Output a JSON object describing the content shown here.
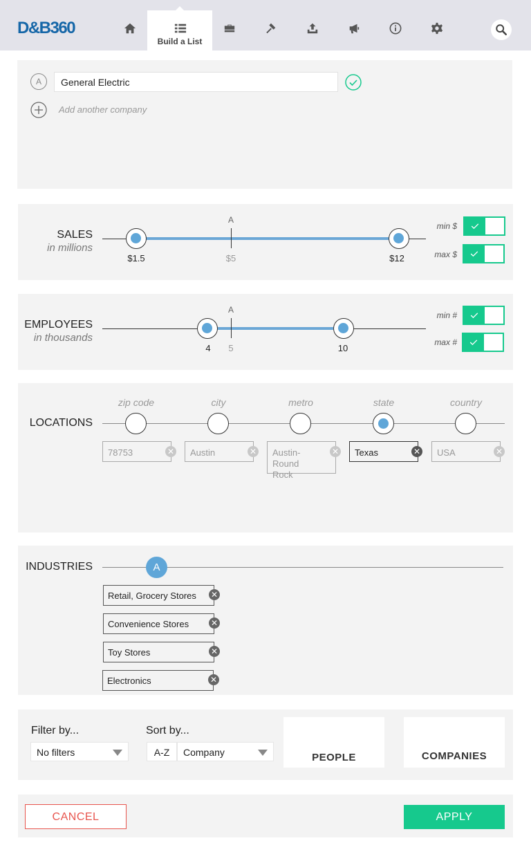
{
  "app": {
    "logo": "D&B360"
  },
  "nav": {
    "items": [
      {
        "icon": "home-icon"
      },
      {
        "icon": "list-icon",
        "label": "Build a List",
        "active": true
      },
      {
        "icon": "briefcase-icon"
      },
      {
        "icon": "gavel-icon"
      },
      {
        "icon": "upload-icon"
      },
      {
        "icon": "megaphone-icon"
      },
      {
        "icon": "info-icon"
      },
      {
        "icon": "gear-icon"
      }
    ],
    "search_icon": "search-icon"
  },
  "companies": {
    "items": [
      {
        "letter": "A",
        "value": "General Electric",
        "verified": true
      }
    ],
    "add_placeholder": "Add another company"
  },
  "sales": {
    "label": "SALES",
    "sublabel": "in millions",
    "marker_letter": "A",
    "min_value": "$1.5",
    "marker_value": "$5",
    "max_value": "$12",
    "min_toggle_label": "min $",
    "max_toggle_label": "max $",
    "min_enabled": true,
    "max_enabled": true
  },
  "employees": {
    "label": "EMPLOYEES",
    "sublabel": "in thousands",
    "marker_letter": "A",
    "min_value": "4",
    "marker_value": "5",
    "max_value": "10",
    "min_toggle_label": "min #",
    "max_toggle_label": "max #",
    "min_enabled": true,
    "max_enabled": true
  },
  "locations": {
    "label": "LOCATIONS",
    "levels": [
      {
        "heading": "zip code",
        "value": "78753",
        "selected": false
      },
      {
        "heading": "city",
        "value": "Austin",
        "selected": false
      },
      {
        "heading": "metro",
        "value": "Austin-Round Rock",
        "selected": false
      },
      {
        "heading": "state",
        "value": "Texas",
        "selected": true
      },
      {
        "heading": "country",
        "value": "USA",
        "selected": false
      }
    ]
  },
  "industries": {
    "label": "INDUSTRIES",
    "marker_letter": "A",
    "items": [
      "Retail, Grocery Stores",
      "Convenience Stores",
      "Toy Stores",
      "Electronics"
    ]
  },
  "filter": {
    "filter_label": "Filter by...",
    "filter_value": "No filters",
    "sort_label": "Sort by...",
    "sort_order": "A-Z",
    "sort_value": "Company",
    "people_button": "PEOPLE",
    "companies_button": "COMPANIES"
  },
  "actions": {
    "cancel": "CANCEL",
    "apply": "APPLY"
  },
  "colors": {
    "accent_green": "#16c98d",
    "slider_blue": "#5fa6d8",
    "logo_blue": "#1667a8",
    "cancel_red": "#e8554e"
  }
}
